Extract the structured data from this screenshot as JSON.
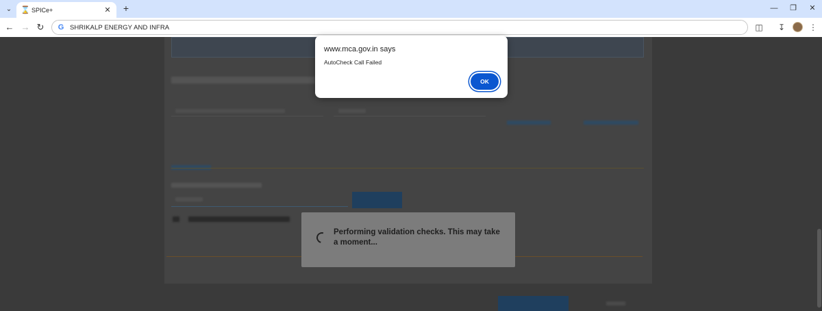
{
  "browser": {
    "tab": {
      "title": "SPICe+"
    },
    "address_bar": {
      "value": "SHRIKALP ENERGY AND INFRA"
    }
  },
  "dialog": {
    "title": "www.mca.gov.in says",
    "message": "AutoCheck Call Failed",
    "ok_label": "OK"
  },
  "loading": {
    "message": "Performing validation checks. This may take a moment..."
  },
  "icons": {
    "tab_search": "chevron-down-icon",
    "favicon": "hourglass-icon",
    "tab_close": "close-icon",
    "new_tab": "plus-icon",
    "back": "arrow-left-icon",
    "forward": "arrow-right-icon",
    "reload": "reload-icon",
    "google": "google-icon",
    "extensions": "puzzle-icon",
    "download": "download-icon",
    "menu": "kebab-menu-icon"
  },
  "colors": {
    "tabstrip": "#d3e3fd",
    "ok_button": "#0b57d0",
    "overlay": "#3a3a3a"
  }
}
